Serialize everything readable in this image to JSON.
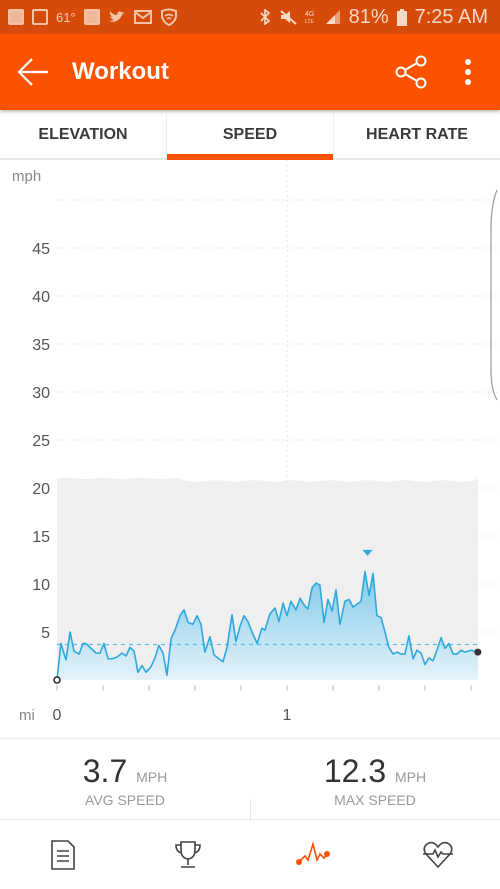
{
  "status_bar": {
    "temperature": "61°",
    "battery": "81%",
    "time": "7:25 AM",
    "icons_left": [
      "bible-app-icon",
      "gallery-icon",
      "weather-temp",
      "bible-app-icon",
      "twitter-icon",
      "gmail-icon",
      "lookout-icon"
    ],
    "icons_right": [
      "bluetooth-icon",
      "mute-icon",
      "4g-lte-icon",
      "signal-icon",
      "battery-icon"
    ]
  },
  "app_bar": {
    "title": "Workout",
    "back_icon": "arrow-left-icon",
    "share_icon": "share-icon",
    "more_icon": "more-vert-icon"
  },
  "tabs": [
    {
      "label": "ELEVATION",
      "active": false
    },
    {
      "label": "SPEED",
      "active": true
    },
    {
      "label": "HEART RATE",
      "active": false
    }
  ],
  "colors": {
    "accent": "#fc5200",
    "status_bar": "#d64b0a",
    "line": "#2ea8de",
    "fill_top": "#7fcaea",
    "fill_bottom": "#e6f2f8",
    "plot_bg": "#efefef"
  },
  "chart_data": {
    "type": "area",
    "title": "",
    "ylabel": "mph",
    "xlabel": "mi",
    "ylim": [
      0,
      50
    ],
    "xlim": [
      0,
      1.83
    ],
    "y_ticks": [
      5,
      10,
      15,
      20,
      25,
      30,
      35,
      40,
      45
    ],
    "x_tick_labels": [
      {
        "value": 0,
        "label": "0"
      },
      {
        "value": 1,
        "label": "1"
      }
    ],
    "x_minor_ticks": [
      0,
      0.2,
      0.4,
      0.6,
      0.8,
      1.0,
      1.2,
      1.4,
      1.6,
      1.8
    ],
    "grid": true,
    "avg_line": 3.7,
    "max_marker": {
      "x": 1.35,
      "y": 12.3
    },
    "series": [
      {
        "name": "Speed",
        "x": [
          0,
          0.017,
          0.039,
          0.057,
          0.074,
          0.096,
          0.113,
          0.126,
          0.148,
          0.17,
          0.187,
          0.204,
          0.222,
          0.239,
          0.261,
          0.283,
          0.3,
          0.317,
          0.335,
          0.352,
          0.37,
          0.387,
          0.409,
          0.426,
          0.443,
          0.461,
          0.478,
          0.496,
          0.513,
          0.535,
          0.552,
          0.57,
          0.591,
          0.609,
          0.626,
          0.643,
          0.665,
          0.683,
          0.704,
          0.722,
          0.739,
          0.761,
          0.778,
          0.796,
          0.813,
          0.83,
          0.848,
          0.87,
          0.891,
          0.904,
          0.926,
          0.948,
          0.965,
          0.983,
          1.0,
          1.017,
          1.039,
          1.057,
          1.078,
          1.091,
          1.109,
          1.126,
          1.143,
          1.161,
          1.178,
          1.196,
          1.213,
          1.23,
          1.252,
          1.27,
          1.287,
          1.322,
          1.339,
          1.357,
          1.374,
          1.391,
          1.409,
          1.426,
          1.443,
          1.461,
          1.478,
          1.496,
          1.513,
          1.53,
          1.548,
          1.565,
          1.583,
          1.6,
          1.617,
          1.635,
          1.652,
          1.67,
          1.687,
          1.704,
          1.722,
          1.739,
          1.757,
          1.774,
          1.8,
          1.83
        ],
        "values": [
          0,
          3.8,
          2.1,
          5.0,
          3.0,
          2.7,
          3.8,
          3.8,
          3.3,
          2.8,
          2.8,
          3.8,
          2.2,
          2.2,
          2.4,
          2.8,
          2.5,
          3.4,
          3.0,
          0.8,
          1.5,
          0.8,
          1.4,
          2.3,
          3.6,
          2.8,
          0.5,
          4.3,
          5.2,
          6.7,
          7.3,
          6.0,
          5.8,
          6.7,
          5.8,
          2.9,
          4.5,
          2.6,
          2.2,
          1.9,
          3.4,
          6.8,
          4.0,
          5.6,
          6.7,
          6.1,
          5.0,
          3.8,
          5.4,
          5.2,
          6.9,
          7.5,
          6.1,
          8.0,
          6.7,
          8.2,
          7.3,
          8.5,
          7.7,
          7.4,
          9.6,
          10.1,
          9.9,
          6.0,
          8.4,
          7.2,
          9.4,
          5.8,
          8.2,
          8.4,
          7.6,
          8.2,
          11.3,
          8.8,
          11.1,
          6.7,
          6.5,
          5.0,
          3.4,
          2.7,
          2.9,
          2.7,
          2.7,
          4.6,
          2.2,
          3.1,
          2.8,
          1.6,
          2.3,
          2.0,
          3.1,
          4.4,
          3.3,
          3.8,
          2.7,
          2.7,
          3.1,
          2.9,
          3.1,
          2.9
        ]
      }
    ]
  },
  "stats": [
    {
      "value": "3.7",
      "unit": "MPH",
      "label": "AVG SPEED"
    },
    {
      "value": "12.3",
      "unit": "MPH",
      "label": "MAX SPEED"
    }
  ],
  "bottom_nav": [
    {
      "icon": "summary-document-icon",
      "active": false
    },
    {
      "icon": "trophy-icon",
      "active": false
    },
    {
      "icon": "analysis-graph-icon",
      "active": true
    },
    {
      "icon": "heart-rate-icon",
      "active": false
    }
  ]
}
